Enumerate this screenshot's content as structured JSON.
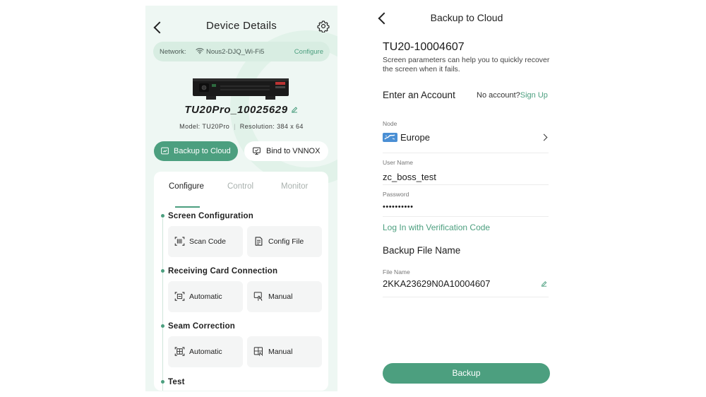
{
  "device_details": {
    "title": "Device Details",
    "network_label": "Network:",
    "network_ssid": "Nous2-DJQ_Wi-Fi5",
    "network_configure": "Configure",
    "device_name": "TU20Pro_10025629",
    "model_label": "Model:",
    "model_value": "TU20Pro",
    "resolution_label": "Resolution:",
    "resolution_value": "384 x 64",
    "backup_button": "Backup to Cloud",
    "bind_button": "Bind to VNNOX",
    "tabs": [
      "Configure",
      "Control",
      "Monitor"
    ],
    "active_tab": "Configure",
    "sections": [
      {
        "title": "Screen Configuration",
        "tiles": [
          {
            "label": "Scan Code",
            "icon": "scan-code-icon"
          },
          {
            "label": "Config File",
            "icon": "config-file-icon"
          }
        ]
      },
      {
        "title": "Receiving Card Connection",
        "tiles": [
          {
            "label": "Automatic",
            "icon": "auto-connect-icon"
          },
          {
            "label": "Manual",
            "icon": "manual-hand-icon"
          }
        ]
      },
      {
        "title": "Seam Correction",
        "tiles": [
          {
            "label": "Automatic",
            "icon": "auto-seam-icon"
          },
          {
            "label": "Manual",
            "icon": "manual-seam-icon"
          }
        ]
      },
      {
        "title": "Test",
        "tiles": []
      }
    ]
  },
  "backup": {
    "title": "Backup to Cloud",
    "device_name": "TU20-10004607",
    "description": "Screen parameters can help you to quickly recover the screen when it fails.",
    "enter_account": "Enter an Account",
    "no_account": "No account?",
    "sign_up": "Sign Up",
    "node_label": "Node",
    "node_value": "Europe",
    "username_label": "User Name",
    "username_value": "zc_boss_test",
    "password_label": "Password",
    "password_value": "••••••••••",
    "verification_link": "Log In with Verification Code",
    "file_section": "Backup File Name",
    "file_label": "File Name",
    "file_value": "2KKA23629N0A10004607",
    "backup_button": "Backup"
  },
  "colors": {
    "accent": "#4c9f7f",
    "left_bg": "#eef7f3",
    "pill_bg": "#d8ede2",
    "tile_bg": "#f4f5f5"
  }
}
